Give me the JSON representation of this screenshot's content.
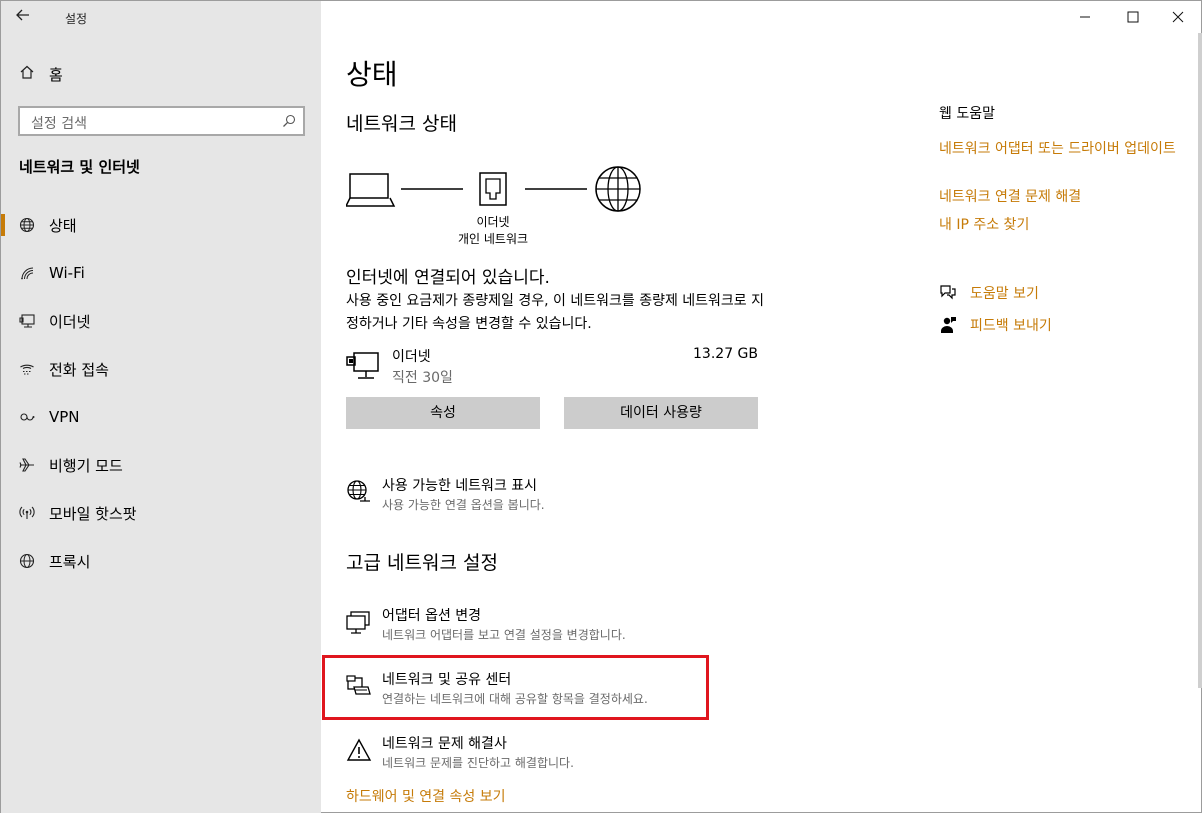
{
  "window": {
    "app_title": "설정",
    "controls": [
      "minimize",
      "maximize",
      "close"
    ]
  },
  "sidebar": {
    "home_label": "홈",
    "search_placeholder": "설정 검색",
    "section_title": "네트워크 및 인터넷",
    "items": [
      {
        "label": "상태",
        "icon": "globe-status-icon",
        "active": true
      },
      {
        "label": "Wi-Fi",
        "icon": "wifi-icon",
        "active": false
      },
      {
        "label": "이더넷",
        "icon": "ethernet-icon",
        "active": false
      },
      {
        "label": "전화 접속",
        "icon": "dial-up-icon",
        "active": false
      },
      {
        "label": "VPN",
        "icon": "vpn-icon",
        "active": false
      },
      {
        "label": "비행기 모드",
        "icon": "airplane-icon",
        "active": false
      },
      {
        "label": "모바일 핫스팟",
        "icon": "hotspot-icon",
        "active": false
      },
      {
        "label": "프록시",
        "icon": "globe-icon",
        "active": false
      }
    ]
  },
  "main": {
    "title": "상태",
    "network_status_heading": "네트워크 상태",
    "diagram": {
      "caption_line1": "이더넷",
      "caption_line2": "개인 네트워크"
    },
    "connected_text": "인터넷에 연결되어 있습니다.",
    "connected_desc": "사용 중인 요금제가 종량제일 경우, 이 네트워크를 종량제 네트워크로 지정하거나 기타 속성을 변경할 수 있습니다.",
    "connection": {
      "name": "이더넷",
      "period": "직전 30일",
      "usage": "13.27 GB"
    },
    "buttons": {
      "properties": "속성",
      "data_usage": "데이터 사용량"
    },
    "show_networks": {
      "title": "사용 가능한 네트워크 표시",
      "desc": "사용 가능한 연결 옵션을 봅니다."
    },
    "advanced_heading": "고급 네트워크 설정",
    "advanced_items": [
      {
        "title": "어댑터 옵션 변경",
        "desc": "네트워크 어댑터를 보고 연결 설정을 변경합니다."
      },
      {
        "title": "네트워크 및 공유 센터",
        "desc": "연결하는 네트워크에 대해 공유할 항목을 결정하세요."
      },
      {
        "title": "네트워크 문제 해결사",
        "desc": "네트워크 문제를 진단하고 해결합니다."
      }
    ],
    "hardware_link": "하드웨어 및 연결 속성 보기"
  },
  "right": {
    "web_help_title": "웹 도움말",
    "links": [
      "네트워크 어댑터 또는 드라이버 업데이트",
      "네트워크 연결 문제 해결",
      "내 IP 주소 찾기"
    ],
    "get_help": "도움말 보기",
    "feedback": "피드백 보내기"
  },
  "colors": {
    "accent": "#c67b08",
    "sidebar_bg": "#e6e6e6",
    "button_bg": "#cccccc",
    "highlight": "#e0161e"
  }
}
